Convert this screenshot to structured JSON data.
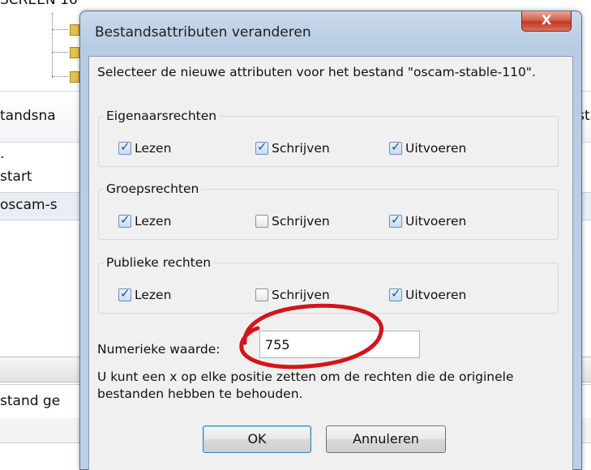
{
  "background": {
    "top_text": "SCREEN 16",
    "column_left": "tandsna",
    "column_right": "Best",
    "rows": [
      ".",
      "start",
      "oscam-s"
    ],
    "bottom_text": "stand ge"
  },
  "dialog": {
    "title": "Bestandsattributen veranderen",
    "close_label": "X",
    "intro": "Selecteer de nieuwe attributen voor het bestand \"oscam-stable-110\".",
    "groups": [
      {
        "legend": "Eigenaarsrechten",
        "options": [
          {
            "label": "Lezen",
            "checked": true
          },
          {
            "label": "Schrijven",
            "checked": true
          },
          {
            "label": "Uitvoeren",
            "checked": true
          }
        ]
      },
      {
        "legend": "Groepsrechten",
        "options": [
          {
            "label": "Lezen",
            "checked": true
          },
          {
            "label": "Schrijven",
            "checked": false
          },
          {
            "label": "Uitvoeren",
            "checked": true
          }
        ]
      },
      {
        "legend": "Publieke rechten",
        "options": [
          {
            "label": "Lezen",
            "checked": true
          },
          {
            "label": "Schrijven",
            "checked": false
          },
          {
            "label": "Uitvoeren",
            "checked": true
          }
        ]
      }
    ],
    "numeric_label": "Numerieke waarde:",
    "numeric_value": "755",
    "note": "U kunt een x op elke positie zetten om de rechten die de originele bestanden hebben te behouden.",
    "ok_label": "OK",
    "cancel_label": "Annuleren",
    "annotation_color": "#d3151b"
  }
}
